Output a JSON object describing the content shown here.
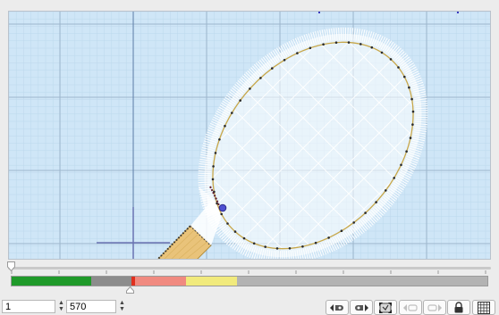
{
  "editor": {
    "grid": {
      "minor_color": "#bcd8ec",
      "major_color": "#9db6cc",
      "background": "#cfe6f7"
    },
    "design": {
      "name": "tennis racket",
      "outline_color": "#c7a74a",
      "fill_color": "#ffffff",
      "handle_color": "#e9c37a"
    }
  },
  "timeline": {
    "slider_value_fraction": 0.0,
    "stitch_position_fraction": 0.25,
    "color_blocks": [
      {
        "color": "#1f9a2a",
        "fraction": 0.168
      },
      {
        "color": "#8c8c8c",
        "fraction": 0.083
      },
      {
        "color": "#e0301e",
        "fraction": 0.009
      },
      {
        "color": "#f08a80",
        "fraction": 0.107
      },
      {
        "color": "#f1ea7c",
        "fraction": 0.107
      },
      {
        "color": "#b3b3b3",
        "fraction": 0.526
      }
    ]
  },
  "footer": {
    "start_stitch": "1",
    "end_stitch": "570"
  },
  "toolbar": {
    "buttons": [
      {
        "name": "previous-color-icon",
        "enabled": true
      },
      {
        "name": "next-color-icon",
        "enabled": true
      },
      {
        "name": "fit-design-icon",
        "enabled": true
      },
      {
        "name": "previous-stitch-icon",
        "enabled": false
      },
      {
        "name": "next-stitch-icon",
        "enabled": false
      },
      {
        "name": "lock-icon",
        "enabled": true
      },
      {
        "name": "grid-icon",
        "enabled": true
      }
    ]
  }
}
